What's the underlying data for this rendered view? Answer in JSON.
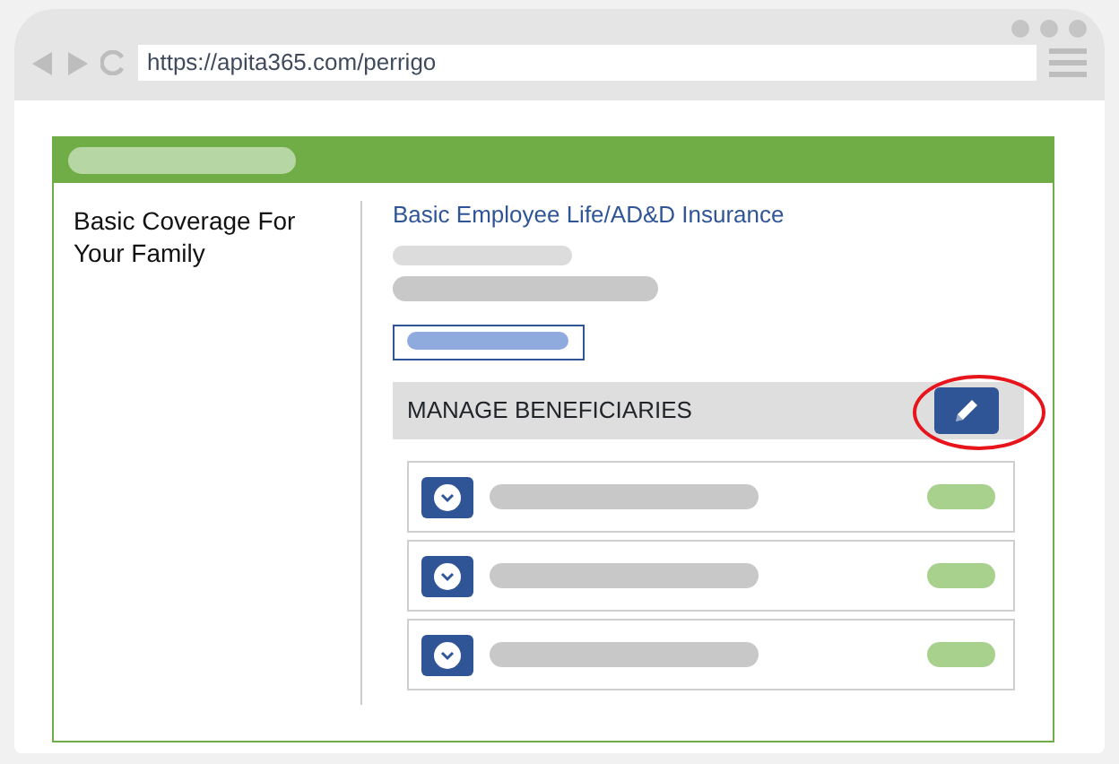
{
  "browser": {
    "url": "https://apita365.com/perrigo"
  },
  "panel": {
    "side_title": "Basic Coverage For Your Family",
    "plan_title": "Basic Employee Life/AD&D Insurance",
    "section": {
      "label": "MANAGE BENEFICIARIES",
      "edit_highlighted": true
    },
    "rows": [
      {
        "kind": "placeholder"
      },
      {
        "kind": "placeholder"
      },
      {
        "kind": "placeholder"
      }
    ]
  }
}
